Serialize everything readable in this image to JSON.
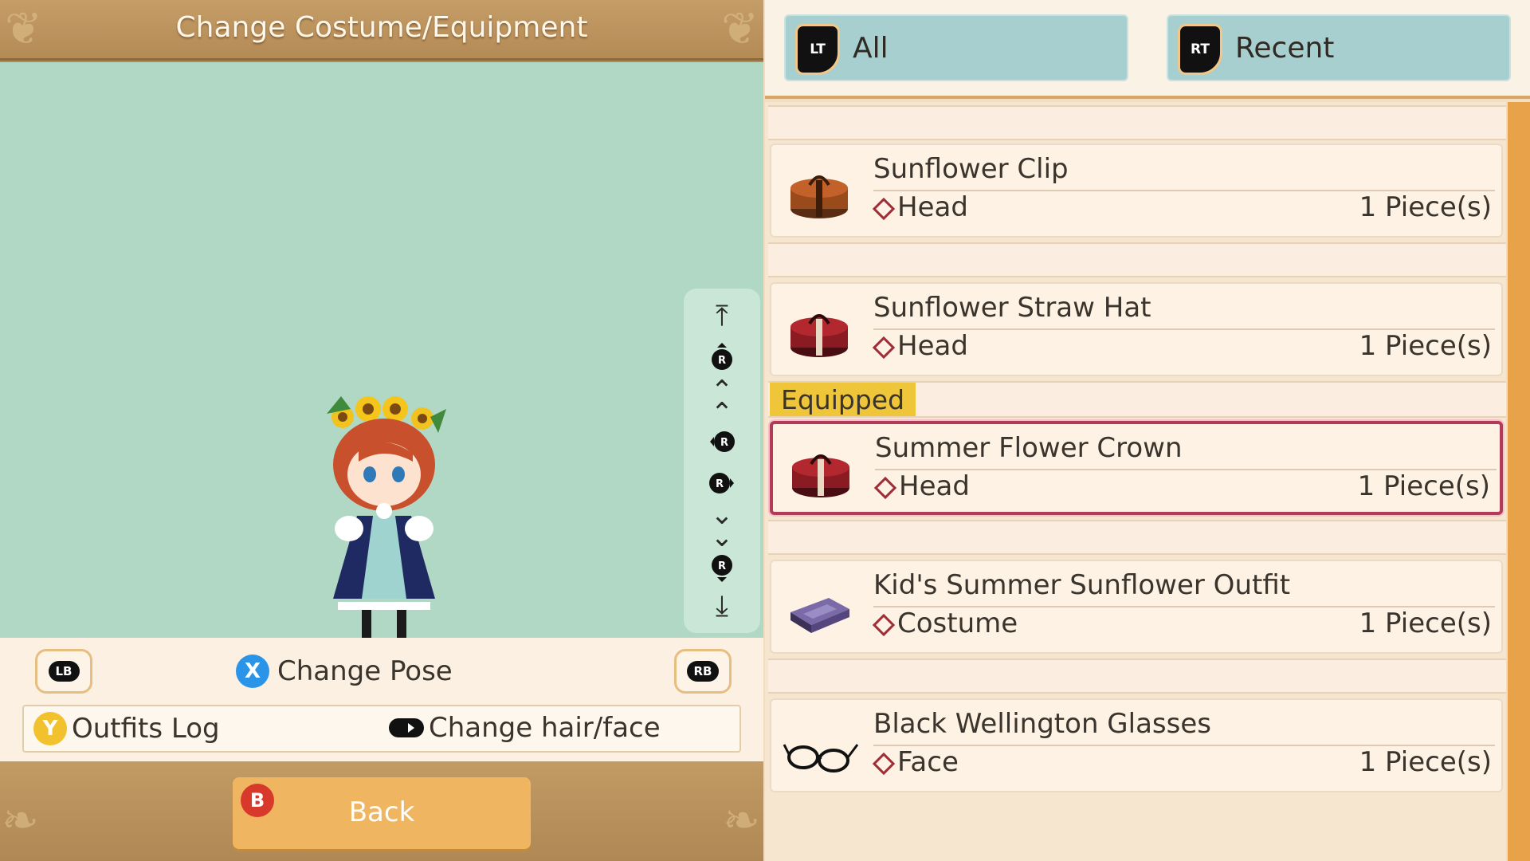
{
  "header": {
    "title": "Change Costume/Equipment"
  },
  "left_panel": {
    "shoulder_left": "LB",
    "shoulder_right": "RB",
    "pose_button": "X",
    "pose_label": "Change Pose",
    "outfits_button": "Y",
    "outfits_label": "Outfits Log",
    "hair_label": "Change hair/face",
    "back_button": "B",
    "back_label": "Back"
  },
  "scroll_controls": [
    "top-arrow-icon",
    "r-stick-up-icon",
    "double-up-arrow-icon",
    "r-stick-left-icon",
    "r-stick-right-icon",
    "double-down-arrow-icon",
    "r-stick-down-icon",
    "bottom-arrow-icon"
  ],
  "tabs": [
    {
      "button": "LT",
      "label": "All"
    },
    {
      "button": "RT",
      "label": "Recent"
    }
  ],
  "equipped_label": "Equipped",
  "items": [
    {
      "name": "Sunflower Clip",
      "category": "Head",
      "count": "1 Piece(s)",
      "icon": "brown-hatbox-icon",
      "selected": false
    },
    {
      "name": "Sunflower Straw Hat",
      "category": "Head",
      "count": "1 Piece(s)",
      "icon": "red-hatbox-icon",
      "selected": false
    },
    {
      "name": "Summer Flower Crown",
      "category": "Head",
      "count": "1 Piece(s)",
      "icon": "red-hatbox-icon",
      "selected": true
    },
    {
      "name": "Kid's Summer Sunflower Outfit",
      "category": "Costume",
      "count": "1 Piece(s)",
      "icon": "costume-box-icon",
      "selected": false
    },
    {
      "name": "Black Wellington Glasses",
      "category": "Face",
      "count": "1 Piece(s)",
      "icon": "glasses-icon",
      "selected": false
    }
  ],
  "colors": {
    "viewport": "#b0d8c5",
    "tab": "#a7cfcf",
    "selected_border": "#b23b57",
    "equipped_tag": "#efc53a",
    "back_button": "#f0b560",
    "x_button": "#2a95e8",
    "y_button": "#f2c12e",
    "b_button": "#d8392b"
  }
}
